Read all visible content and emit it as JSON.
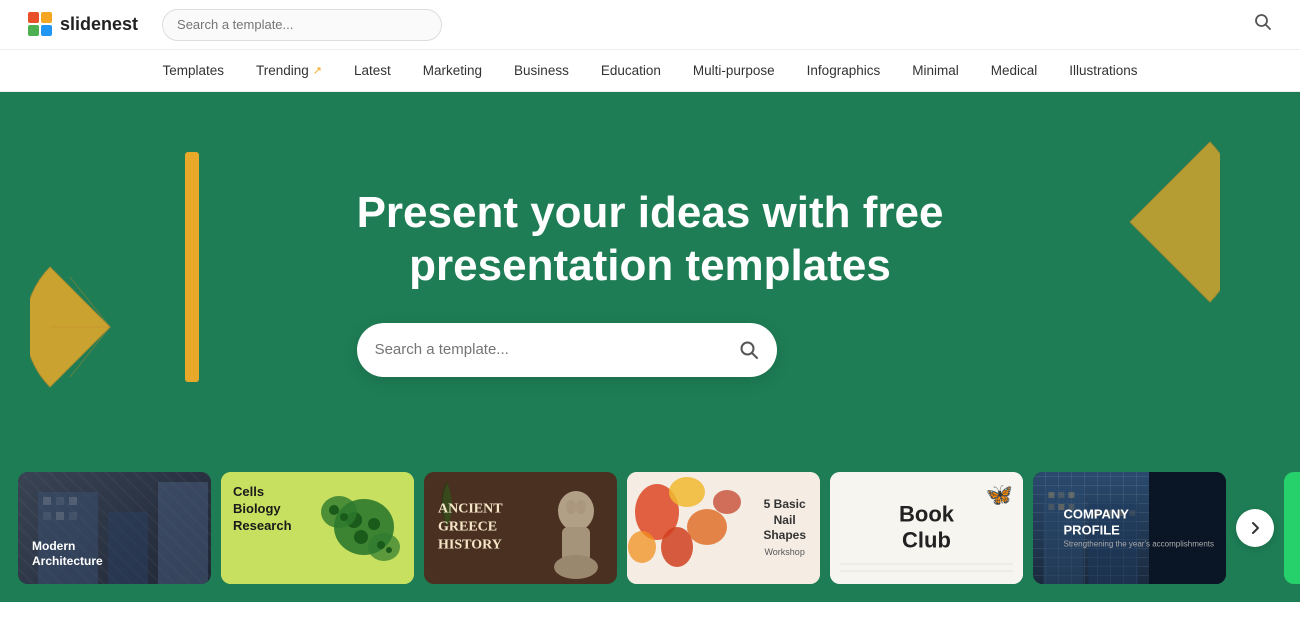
{
  "header": {
    "logo_text": "slidenest",
    "search_placeholder": "Search a template...",
    "search_icon": "🔍"
  },
  "nav": {
    "items": [
      {
        "label": "Templates",
        "trending": false
      },
      {
        "label": "Trending",
        "trending": true
      },
      {
        "label": "Latest",
        "trending": false
      },
      {
        "label": "Marketing",
        "trending": false
      },
      {
        "label": "Business",
        "trending": false
      },
      {
        "label": "Education",
        "trending": false
      },
      {
        "label": "Multi-purpose",
        "trending": false
      },
      {
        "label": "Infographics",
        "trending": false
      },
      {
        "label": "Minimal",
        "trending": false
      },
      {
        "label": "Medical",
        "trending": false
      },
      {
        "label": "Illustrations",
        "trending": false
      }
    ]
  },
  "hero": {
    "title_line1": "Present your ideas with free",
    "title_line2": "presentation templates",
    "search_placeholder": "Search a template..."
  },
  "cards": [
    {
      "id": "modern-architecture",
      "title": "Modern\nArchitecture",
      "bg": "#2a3240"
    },
    {
      "id": "cells-biology",
      "title": "Cells\nBiology\nResearch",
      "bg": "#d4e86e"
    },
    {
      "id": "ancient-greece",
      "title": "ANCIENT\nGREECE\nHISTORY",
      "bg": "#4a3020"
    },
    {
      "id": "nail-shapes",
      "title": "5 Basic\nNail\nShapes\nWorkshop",
      "bg": "#f5e8dc"
    },
    {
      "id": "book-club",
      "title": "Book\nClub",
      "bg": "#f7f5f0"
    },
    {
      "id": "company-profile",
      "title": "COMPANY\nPROFILE",
      "subtitle": "Strengthening the year's accomplishments",
      "bg": "#111827"
    }
  ]
}
